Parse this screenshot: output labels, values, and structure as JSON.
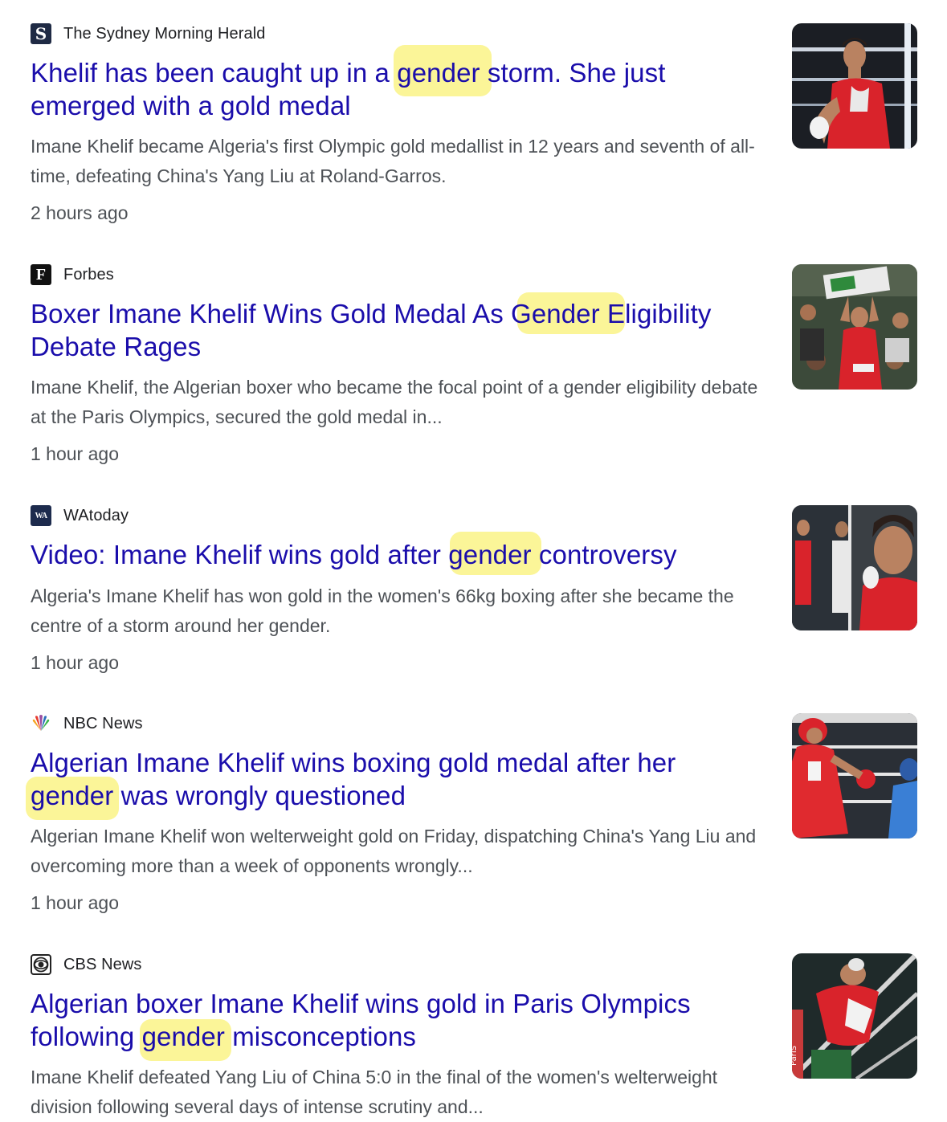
{
  "results": [
    {
      "source": "The Sydney Morning Herald",
      "favicon": "smh-logo-icon",
      "title": "Khelif has been caught up in a gender storm. She just emerged with a gold medal",
      "snippet": "Imane Khelif became Algeria's first Olympic gold medallist in 12 years and seventh of all-time, defeating China's Yang Liu at Roland-Garros.",
      "time": "2 hours ago"
    },
    {
      "source": "Forbes",
      "favicon": "forbes-logo-icon",
      "title": "Boxer Imane Khelif Wins Gold Medal As Gender Eligibility Debate Rages",
      "snippet": "Imane Khelif, the Algerian boxer who became the focal point of a gender eligibility debate at the Paris Olympics, secured the gold medal in...",
      "time": "1 hour ago"
    },
    {
      "source": "WAtoday",
      "favicon": "watoday-logo-icon",
      "title": "Video: Imane Khelif wins gold after gender controversy",
      "snippet": "Algeria's Imane Khelif has won gold in the women's 66kg boxing after she became the centre of a storm around her gender.",
      "time": "1 hour ago"
    },
    {
      "source": "NBC News",
      "favicon": "nbc-peacock-icon",
      "title": "Algerian Imane Khelif wins boxing gold medal after her gender was wrongly questioned",
      "snippet": "Algerian Imane Khelif won welterweight gold on Friday, dispatching China's Yang Liu and overcoming more than a week of opponents wrongly...",
      "time": "1 hour ago"
    },
    {
      "source": "CBS News",
      "favicon": "cbs-eye-icon",
      "title": "Algerian boxer Imane Khelif wins gold in Paris Olympics following gender misconceptions",
      "snippet": "Imane Khelif defeated Yang Liu of China 5:0 in the final of the women's welterweight division following several days of intense scrutiny and...",
      "time": ""
    }
  ],
  "favicon_letters": {
    "smh": "S",
    "forbes": "F",
    "wa": "WA"
  },
  "thumb_text": {
    "cbs": "ParIS"
  },
  "colors": {
    "title": "#1a0dab",
    "snippet": "#4d5156",
    "source": "#202124",
    "highlight": "#fbf598"
  }
}
